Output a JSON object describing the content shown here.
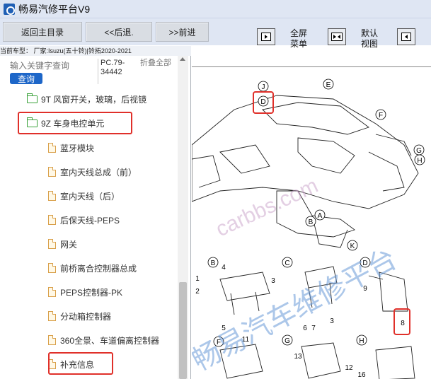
{
  "window": {
    "title": "畅易汽修平台V9"
  },
  "toolbar": {
    "back_label": "返回主目录",
    "prev_label": "<<后退.",
    "next_label": ">>前进",
    "fullscreen_label": "全屏菜单",
    "default_view_label": "默认视图"
  },
  "vehicle_line": "当前车型： 厂家:Isuzu(五十铃)|铃拓2020-2021",
  "search": {
    "placeholder": "输入关键字查询",
    "button_label": "查询",
    "code": "PC.79-34442",
    "fold_label": "折叠全部"
  },
  "tree": {
    "folders": [
      {
        "label": "9T 风窗开关，玻璃，后视镜"
      },
      {
        "label": "9Z 车身电控单元"
      }
    ],
    "docs": [
      {
        "label": "蓝牙模块"
      },
      {
        "label": "室内天线总成（前）"
      },
      {
        "label": "室内天线（后）"
      },
      {
        "label": "后保天线-PEPS"
      },
      {
        "label": "网关"
      },
      {
        "label": "前桥离合控制器总成"
      },
      {
        "label": "PEPS控制器-PK"
      },
      {
        "label": "分动箱控制器"
      },
      {
        "label": "360全景、车道偏离控制器"
      },
      {
        "label": "补充信息"
      }
    ]
  },
  "diagram": {
    "callouts": [
      "J",
      "E",
      "D",
      "F",
      "G",
      "H",
      "A",
      "B",
      "K",
      "C",
      "D",
      "B",
      "C",
      "D",
      "F",
      "G",
      "H"
    ],
    "part_numbers": [
      "4",
      "3",
      "5",
      "1",
      "2",
      "6",
      "7",
      "3",
      "9",
      "8",
      "11",
      "13",
      "12",
      "16"
    ],
    "watermark1": "carbbs.com",
    "watermark2": "畅易汽车维修平台"
  },
  "colors": {
    "highlight": "#e0302a",
    "accent": "#1d66c8",
    "folder": "#3aa23a"
  }
}
